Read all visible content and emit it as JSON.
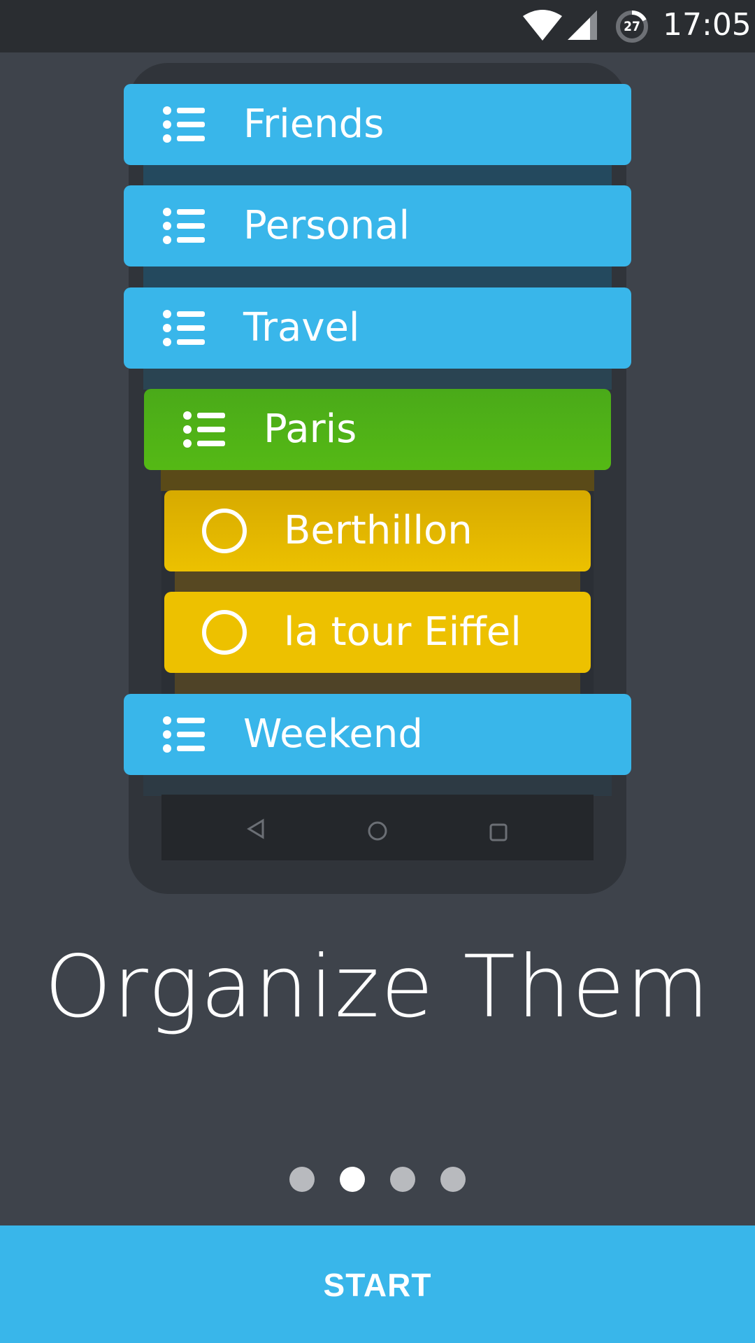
{
  "status_bar": {
    "time": "17:05",
    "battery_level": "27",
    "icons": [
      "wifi-icon",
      "signal-icon",
      "battery-icon"
    ]
  },
  "mockup": {
    "lists": [
      {
        "label": "Friends",
        "type": "list",
        "color": "#39b6ea"
      },
      {
        "label": "Personal",
        "type": "list",
        "color": "#39b6ea"
      },
      {
        "label": "Travel",
        "type": "list",
        "color": "#39b6ea"
      },
      {
        "label": "Paris",
        "type": "sublist",
        "color": "#4fb516"
      },
      {
        "label": "Berthillon",
        "type": "task",
        "color": "#ecc100"
      },
      {
        "label": "la tour Eiffel",
        "type": "task",
        "color": "#ecc100"
      },
      {
        "label": "Weekend",
        "type": "list",
        "color": "#39b6ea"
      }
    ],
    "nav_icons": [
      "back-icon",
      "home-icon",
      "recents-icon"
    ]
  },
  "headline": "Organize Them",
  "pager": {
    "count": 4,
    "active_index": 1
  },
  "start_button": {
    "label": "START"
  },
  "colors": {
    "background": "#3e434b",
    "accent_blue": "#39b6ea",
    "green": "#4fb516",
    "yellow": "#ecc100"
  }
}
